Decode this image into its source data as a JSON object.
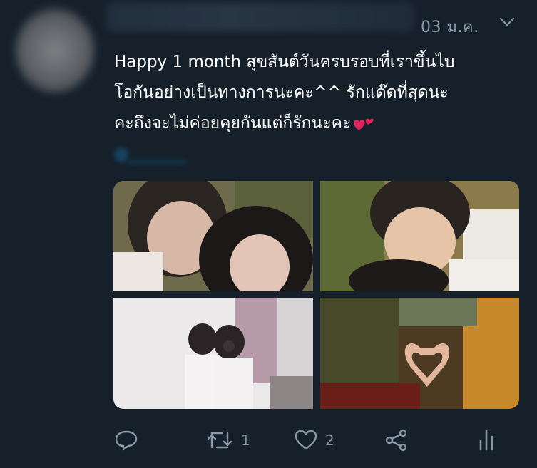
{
  "tweet": {
    "timestamp": "03 ม.ค.",
    "text_line1": "Happy 1 month สุขสันต์วันครบรอบที่เราขึ้นไบ",
    "text_line2": "โอกันอย่างเป็นทางการนะคะ^^ รักแด๊ดที่สุดนะ",
    "text_line3": "คะถึงจะไม่ค่อยคุยกันแต่ก็รักนะคะ",
    "emoji": "two-hearts-emoji"
  },
  "actions": {
    "reply_icon": "reply-icon",
    "retweet_icon": "retweet-icon",
    "retweet_count": "1",
    "like_icon": "heart-icon",
    "like_count": "2",
    "share_icon": "share-icon",
    "stats_icon": "analytics-icon"
  },
  "colors": {
    "background": "#15202b",
    "text": "#ffffff",
    "muted": "#8899a6",
    "accent": "#1da1f2"
  }
}
